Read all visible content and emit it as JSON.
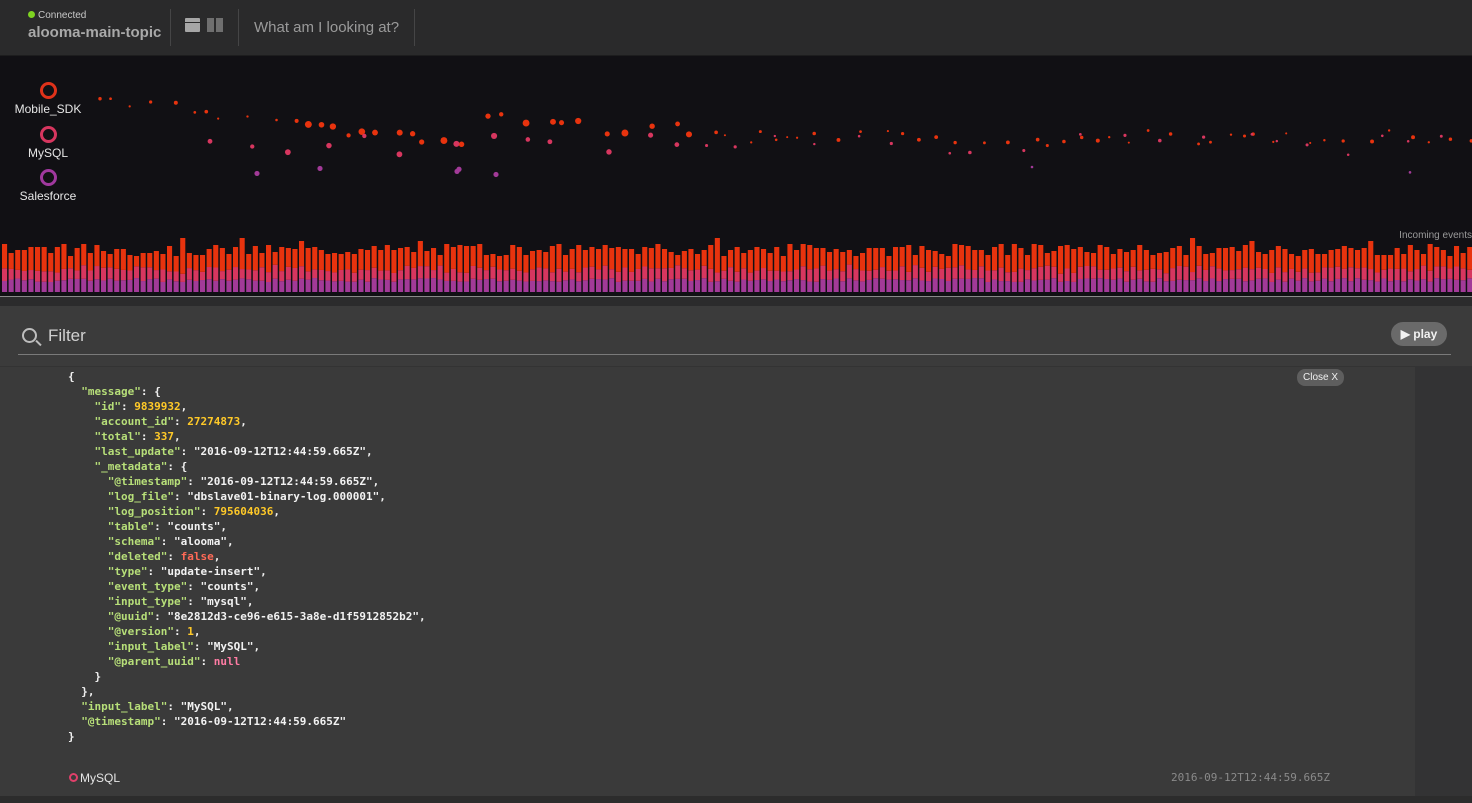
{
  "header": {
    "status": "Connected",
    "topic": "alooma-main-topic",
    "help_link": "What am I looking at?"
  },
  "viz": {
    "legend": [
      {
        "label": "Mobile_SDK",
        "color": "#e0321a"
      },
      {
        "label": "MySQL",
        "color": "#d7365f"
      },
      {
        "label": "Salesforce",
        "color": "#a0389e"
      }
    ],
    "incoming_label": "Incoming events",
    "colors": {
      "bar_top": "#e8330e",
      "bar_mid": "#d7365f",
      "bar_low": "#a23a98"
    }
  },
  "filter": {
    "placeholder": "Filter",
    "play_label": "▶ play"
  },
  "event": {
    "close_label": "Close X",
    "source": "MySQL",
    "timestamp": "2016-09-12T12:44:59.665Z",
    "lines": [
      [
        [
          "s",
          "{"
        ]
      ],
      [
        [
          "s",
          "  "
        ],
        [
          "k",
          "\"message\""
        ],
        [
          "s",
          ": {"
        ]
      ],
      [
        [
          "s",
          "    "
        ],
        [
          "k",
          "\"id\""
        ],
        [
          "s",
          ": "
        ],
        [
          "n",
          "9839932"
        ],
        [
          "s",
          ","
        ]
      ],
      [
        [
          "s",
          "    "
        ],
        [
          "k",
          "\"account_id\""
        ],
        [
          "s",
          ": "
        ],
        [
          "n",
          "27274873"
        ],
        [
          "s",
          ","
        ]
      ],
      [
        [
          "s",
          "    "
        ],
        [
          "k",
          "\"total\""
        ],
        [
          "s",
          ": "
        ],
        [
          "n",
          "337"
        ],
        [
          "s",
          ","
        ]
      ],
      [
        [
          "s",
          "    "
        ],
        [
          "k",
          "\"last_update\""
        ],
        [
          "s",
          ": \"2016-09-12T12:44:59.665Z\","
        ]
      ],
      [
        [
          "s",
          "    "
        ],
        [
          "k",
          "\"_metadata\""
        ],
        [
          "s",
          ": {"
        ]
      ],
      [
        [
          "s",
          "      "
        ],
        [
          "k",
          "\"@timestamp\""
        ],
        [
          "s",
          ": \"2016-09-12T12:44:59.665Z\","
        ]
      ],
      [
        [
          "s",
          "      "
        ],
        [
          "k",
          "\"log_file\""
        ],
        [
          "s",
          ": \"dbslave01-binary-log.000001\","
        ]
      ],
      [
        [
          "s",
          "      "
        ],
        [
          "k",
          "\"log_position\""
        ],
        [
          "s",
          ": "
        ],
        [
          "n",
          "795604036"
        ],
        [
          "s",
          ","
        ]
      ],
      [
        [
          "s",
          "      "
        ],
        [
          "k",
          "\"table\""
        ],
        [
          "s",
          ": \"counts\","
        ]
      ],
      [
        [
          "s",
          "      "
        ],
        [
          "k",
          "\"schema\""
        ],
        [
          "s",
          ": \"alooma\","
        ]
      ],
      [
        [
          "s",
          "      "
        ],
        [
          "k",
          "\"deleted\""
        ],
        [
          "s",
          ": "
        ],
        [
          "b",
          "false"
        ],
        [
          "s",
          ","
        ]
      ],
      [
        [
          "s",
          "      "
        ],
        [
          "k",
          "\"type\""
        ],
        [
          "s",
          ": \"update-insert\","
        ]
      ],
      [
        [
          "s",
          "      "
        ],
        [
          "k",
          "\"event_type\""
        ],
        [
          "s",
          ": \"counts\","
        ]
      ],
      [
        [
          "s",
          "      "
        ],
        [
          "k",
          "\"input_type\""
        ],
        [
          "s",
          ": \"mysql\","
        ]
      ],
      [
        [
          "s",
          "      "
        ],
        [
          "k",
          "\"@uuid\""
        ],
        [
          "s",
          ": \"8e2812d3-ce96-e615-3a8e-d1f5912852b2\","
        ]
      ],
      [
        [
          "s",
          "      "
        ],
        [
          "k",
          "\"@version\""
        ],
        [
          "s",
          ": "
        ],
        [
          "n",
          "1"
        ],
        [
          "s",
          ","
        ]
      ],
      [
        [
          "s",
          "      "
        ],
        [
          "k",
          "\"input_label\""
        ],
        [
          "s",
          ": \"MySQL\","
        ]
      ],
      [
        [
          "s",
          "      "
        ],
        [
          "k",
          "\"@parent_uuid\""
        ],
        [
          "s",
          ": "
        ],
        [
          "nl",
          "null"
        ]
      ],
      [
        [
          "s",
          "    }"
        ]
      ],
      [
        [
          "s",
          "  },"
        ]
      ],
      [
        [
          "s",
          "  "
        ],
        [
          "k",
          "\"input_label\""
        ],
        [
          "s",
          ": \"MySQL\","
        ]
      ],
      [
        [
          "s",
          "  "
        ],
        [
          "k",
          "\"@timestamp\""
        ],
        [
          "s",
          ": \"2016-09-12T12:44:59.665Z\""
        ]
      ],
      [
        [
          "s",
          "}"
        ]
      ]
    ]
  }
}
